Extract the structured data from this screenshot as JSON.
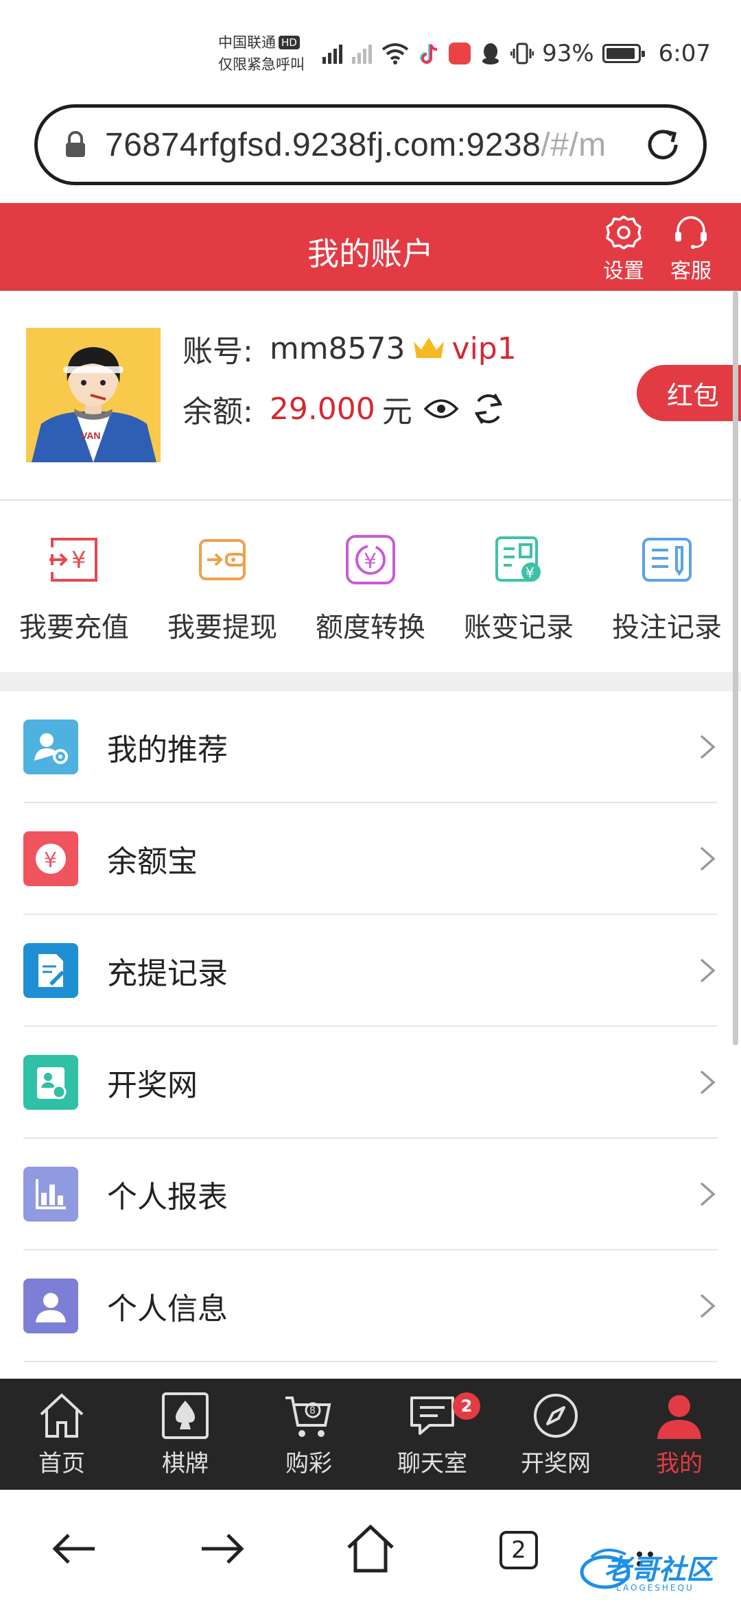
{
  "status_bar": {
    "carrier": "中国联通",
    "carrier_badge": "HD",
    "emergency": "仅限紧急呼叫",
    "battery": "93%",
    "battery_level": 0.93,
    "time": "6:07",
    "icons": [
      "signal-icon",
      "signal-no-sim-icon",
      "wifi-icon",
      "tiktok-icon",
      "huawei-store-icon",
      "qq-icon",
      "vibrate-icon",
      "battery-icon"
    ]
  },
  "browser": {
    "url_main": "76874rfgfsd.9238fj.com:9238",
    "url_rest": "/#/m"
  },
  "header": {
    "title": "我的账户",
    "settings_label": "设置",
    "service_label": "客服",
    "color": "#e33b44"
  },
  "account": {
    "account_label": "账号:",
    "account_value": "mm8573",
    "vip": "vip1",
    "balance_label": "余额:",
    "balance_value": "29.000",
    "balance_unit": "元",
    "red_packet": "红包"
  },
  "quick_actions": [
    {
      "label": "我要充值",
      "icon": "recharge-icon",
      "color": "#e9474f"
    },
    {
      "label": "我要提现",
      "icon": "withdraw-icon",
      "color": "#f0a04b"
    },
    {
      "label": "额度转换",
      "icon": "transfer-icon",
      "color": "#c95bd8"
    },
    {
      "label": "账变记录",
      "icon": "account-change-icon",
      "color": "#3cc2a8"
    },
    {
      "label": "投注记录",
      "icon": "bet-record-icon",
      "color": "#5aa3e6"
    }
  ],
  "menu": [
    {
      "label": "我的推荐",
      "icon": "referral-icon",
      "color": "#4fb1df"
    },
    {
      "label": "余额宝",
      "icon": "yuebao-icon",
      "color": "#f0545f"
    },
    {
      "label": "充提记录",
      "icon": "deposit-record-icon",
      "color": "#1f8fd3"
    },
    {
      "label": "开奖网",
      "icon": "lottery-site-icon",
      "color": "#2fc0a6"
    },
    {
      "label": "个人报表",
      "icon": "report-icon",
      "color": "#8f9ae0"
    },
    {
      "label": "个人信息",
      "icon": "profile-icon",
      "color": "#7d7fd6"
    }
  ],
  "tabbar": {
    "items": [
      {
        "label": "首页",
        "icon": "home-icon"
      },
      {
        "label": "棋牌",
        "icon": "cards-icon"
      },
      {
        "label": "购彩",
        "icon": "lottery-cart-icon"
      },
      {
        "label": "聊天室",
        "icon": "chat-icon",
        "badge": "2"
      },
      {
        "label": "开奖网",
        "icon": "compass-icon"
      },
      {
        "label": "我的",
        "icon": "user-icon"
      }
    ]
  },
  "browser_nav": {
    "tab_count": "2",
    "watermark": "老哥社区",
    "watermark_sub": "LAOGESHEQU"
  }
}
